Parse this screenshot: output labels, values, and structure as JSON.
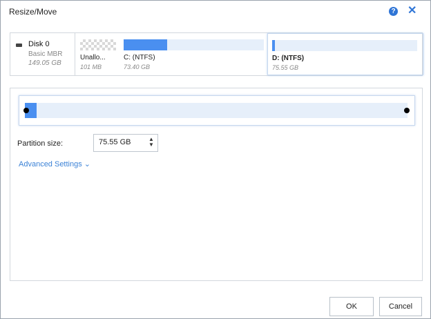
{
  "dialog": {
    "title": "Resize/Move",
    "help_icon": "question-circle-icon",
    "close_icon": "close-icon",
    "accent_color": "#2f75d6"
  },
  "disk": {
    "name": "Disk 0",
    "type": "Basic MBR",
    "size": "149.05 GB",
    "icon": "disk-drive-icon"
  },
  "partitions": [
    {
      "name": "Unallo...",
      "size": "101 MB",
      "used_fraction": 0
    },
    {
      "name": "C:  (NTFS)",
      "size": "73.40 GB",
      "used_fraction": 0.31
    },
    {
      "name": "D:  (NTFS)",
      "size": "75.55 GB",
      "used_fraction": 0.02,
      "selected": true
    }
  ],
  "resize": {
    "used_fraction": 0.03
  },
  "partition_size": {
    "label": "Partition size:",
    "value": "75.55 GB"
  },
  "advanced_settings": {
    "label": "Advanced Settings",
    "icon": "chevron-down-icon"
  },
  "buttons": {
    "ok": "OK",
    "cancel": "Cancel"
  }
}
